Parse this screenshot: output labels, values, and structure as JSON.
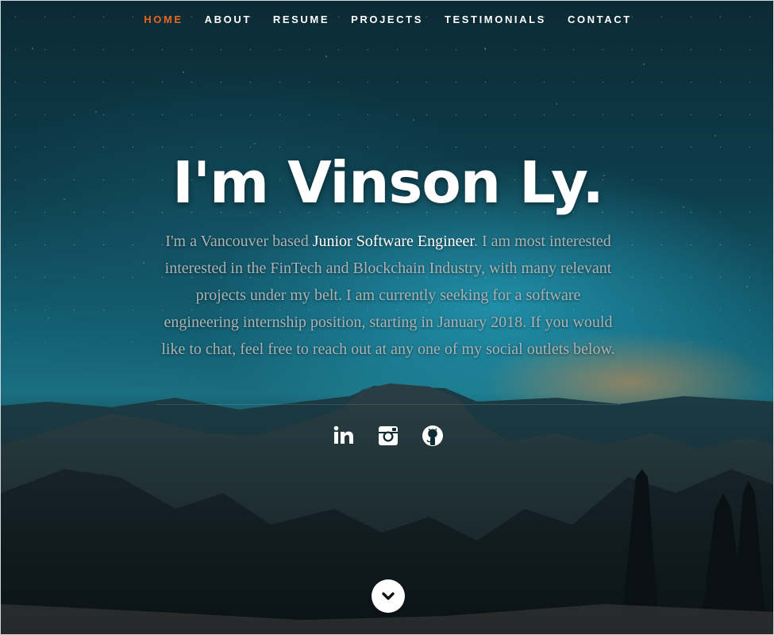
{
  "nav": {
    "items": [
      {
        "label": "HOME",
        "active": true
      },
      {
        "label": "ABOUT"
      },
      {
        "label": "RESUME"
      },
      {
        "label": "PROJECTS"
      },
      {
        "label": "TESTIMONIALS"
      },
      {
        "label": "CONTACT"
      }
    ],
    "active_color": "#e8671d"
  },
  "hero": {
    "title": "I'm Vinson Ly.",
    "intro_before": "I'm a Vancouver based ",
    "intro_highlight": "Junior Software Engineer",
    "intro_after": ". I am most interested interested in the FinTech and Blockchain Industry, with many relevant projects under my belt. I am currently seeking for a software engineering internship position, starting in January 2018. If you would like to chat, feel free to reach out at any one of my social outlets below."
  },
  "social": [
    {
      "icon": "linkedin-icon"
    },
    {
      "icon": "instagram-icon"
    },
    {
      "icon": "github-icon"
    }
  ],
  "scroll_button": {
    "icon": "chevron-down-icon"
  }
}
